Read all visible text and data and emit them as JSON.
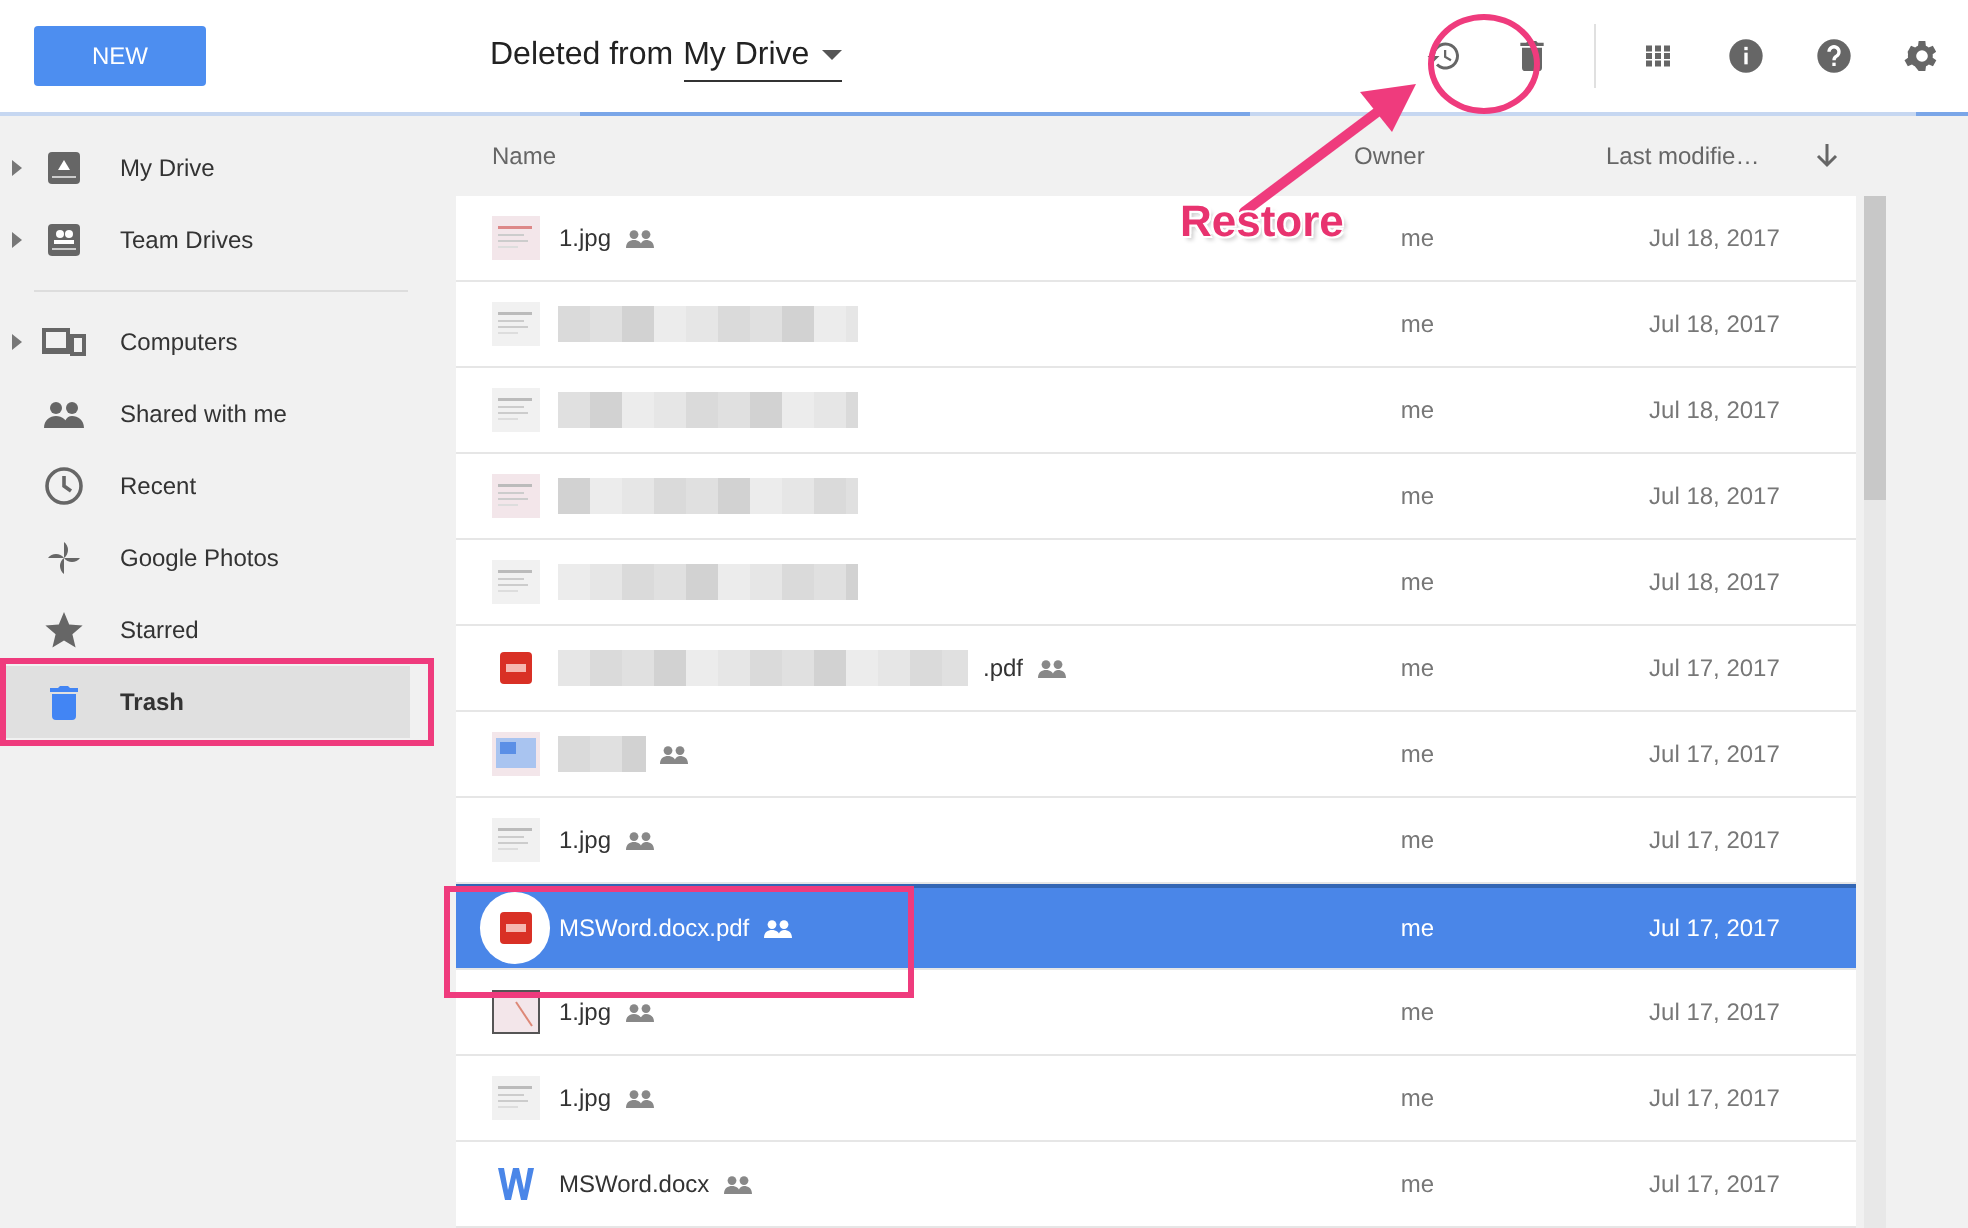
{
  "toolbar": {
    "new_button": "NEW",
    "title_prefix": "Deleted from",
    "title_location": "My Drive",
    "actions": [
      {
        "kind": "restore"
      },
      {
        "kind": "trash"
      },
      {
        "kind": "divider"
      },
      {
        "kind": "grid"
      },
      {
        "kind": "info"
      },
      {
        "kind": "help"
      },
      {
        "kind": "settings"
      }
    ]
  },
  "sidebar": {
    "items": [
      {
        "label": "My Drive",
        "kind": "drive",
        "expandable": true,
        "selected": false
      },
      {
        "label": "Team Drives",
        "kind": "team",
        "expandable": true,
        "selected": false
      },
      {
        "label": "Computers",
        "kind": "computers",
        "expandable": true,
        "selected": false,
        "divider_before": true
      },
      {
        "label": "Shared with me",
        "kind": "shared",
        "expandable": false,
        "selected": false
      },
      {
        "label": "Recent",
        "kind": "recent",
        "expandable": false,
        "selected": false
      },
      {
        "label": "Google Photos",
        "kind": "photos",
        "expandable": false,
        "selected": false
      },
      {
        "label": "Starred",
        "kind": "star",
        "expandable": false,
        "selected": false
      },
      {
        "label": "Trash",
        "kind": "trash",
        "expandable": false,
        "selected": true
      }
    ]
  },
  "table": {
    "columns": [
      "Name",
      "Owner",
      "Last modifie…"
    ],
    "sort_descending": true,
    "rows": [
      {
        "kind": "image",
        "name": "1.jpg",
        "blurred": false,
        "shared": true,
        "owner": "me",
        "modified": "Jul 18, 2017",
        "selected": false
      },
      {
        "kind": "image",
        "blurred": true,
        "shared": false,
        "owner": "me",
        "modified": "Jul 18, 2017",
        "selected": false
      },
      {
        "kind": "image",
        "blurred": true,
        "shared": false,
        "owner": "me",
        "modified": "Jul 18, 2017",
        "selected": false
      },
      {
        "kind": "image",
        "blurred": true,
        "shared": false,
        "owner": "me",
        "modified": "Jul 18, 2017",
        "selected": false
      },
      {
        "kind": "image",
        "blurred": true,
        "shared": false,
        "owner": "me",
        "modified": "Jul 18, 2017",
        "selected": false
      },
      {
        "kind": "pdf",
        "name": ".pdf",
        "blurred": true,
        "shared": true,
        "owner": "me",
        "modified": "Jul 17, 2017",
        "selected": false
      },
      {
        "kind": "image",
        "blurred": true,
        "shared": true,
        "owner": "me",
        "modified": "Jul 17, 2017",
        "selected": false
      },
      {
        "kind": "image",
        "name": "1.jpg",
        "blurred": false,
        "shared": true,
        "owner": "me",
        "modified": "Jul 17, 2017",
        "selected": false
      },
      {
        "kind": "pdf",
        "name": "MSWord.docx.pdf",
        "blurred": false,
        "shared": true,
        "owner": "me",
        "modified": "Jul 17, 2017",
        "selected": true
      },
      {
        "kind": "image",
        "name": "1.jpg",
        "blurred": false,
        "shared": true,
        "owner": "me",
        "modified": "Jul 17, 2017",
        "selected": false
      },
      {
        "kind": "image",
        "name": "1.jpg",
        "blurred": false,
        "shared": true,
        "owner": "me",
        "modified": "Jul 17, 2017",
        "selected": false
      },
      {
        "kind": "word",
        "name": "MSWord.docx",
        "blurred": false,
        "shared": true,
        "owner": "me",
        "modified": "Jul 17, 2017",
        "selected": false
      }
    ]
  },
  "annotation": {
    "callout": "Restore"
  }
}
